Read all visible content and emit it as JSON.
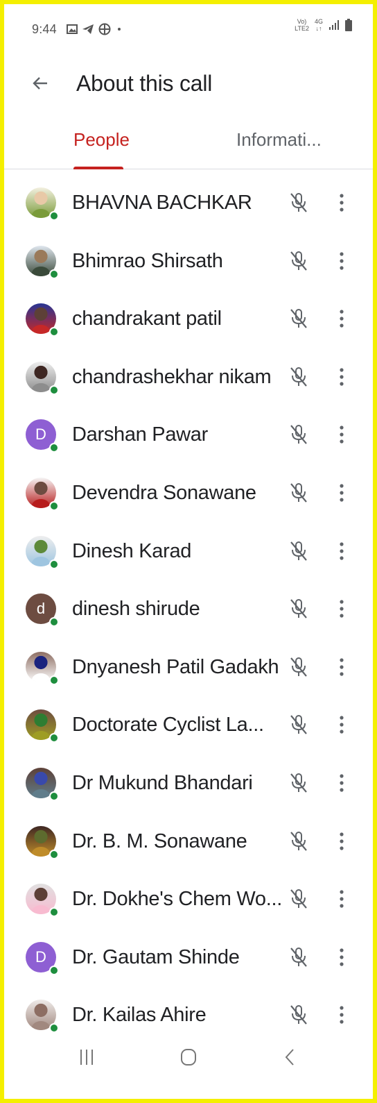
{
  "status_bar": {
    "time": "9:44",
    "left_icons": [
      "gallery-icon",
      "telegram-icon",
      "app-icon"
    ],
    "volte_top": "Vo)",
    "volte_bottom": "LTE2",
    "network": "4G"
  },
  "app_bar": {
    "title": "About this call",
    "back_icon": "arrow-left-icon"
  },
  "tabs": [
    {
      "label": "People",
      "active": true
    },
    {
      "label": "Informati...",
      "active": false
    }
  ],
  "colors": {
    "accent": "#c5221f",
    "presence": "#1e8e3e",
    "border": "#f4ef00"
  },
  "people": [
    {
      "name": "BHAVNA BACHKAR",
      "avatar": "photo",
      "muted": true
    },
    {
      "name": "Bhimrao Shirsath",
      "avatar": "photo",
      "muted": true
    },
    {
      "name": "chandrakant patil",
      "avatar": "photo",
      "muted": true
    },
    {
      "name": "chandrashekhar nikam",
      "avatar": "photo",
      "muted": true
    },
    {
      "name": "Darshan Pawar",
      "avatar": "letter",
      "letter": "D",
      "color": "#8e5fd3",
      "muted": true
    },
    {
      "name": "Devendra Sonawane",
      "avatar": "photo",
      "muted": true
    },
    {
      "name": "Dinesh Karad",
      "avatar": "photo",
      "muted": true
    },
    {
      "name": "dinesh shirude",
      "avatar": "letter",
      "letter": "d",
      "color": "#6d4c41",
      "muted": true
    },
    {
      "name": "Dnyanesh Patil Gadakh",
      "avatar": "photo",
      "muted": true
    },
    {
      "name": "Doctorate Cyclist La...",
      "avatar": "photo",
      "muted": true
    },
    {
      "name": "Dr Mukund Bhandari",
      "avatar": "photo",
      "muted": true
    },
    {
      "name": "Dr. B. M. Sonawane",
      "avatar": "photo",
      "muted": true
    },
    {
      "name": "Dr. Dokhe's Chem Wo...",
      "avatar": "photo",
      "muted": true
    },
    {
      "name": "Dr. Gautam Shinde",
      "avatar": "letter",
      "letter": "D",
      "color": "#8e5fd3",
      "muted": true
    },
    {
      "name": "Dr. Kailas Ahire",
      "avatar": "photo",
      "muted": true
    }
  ],
  "nav_bar": [
    "recents-icon",
    "home-icon",
    "back-icon"
  ]
}
